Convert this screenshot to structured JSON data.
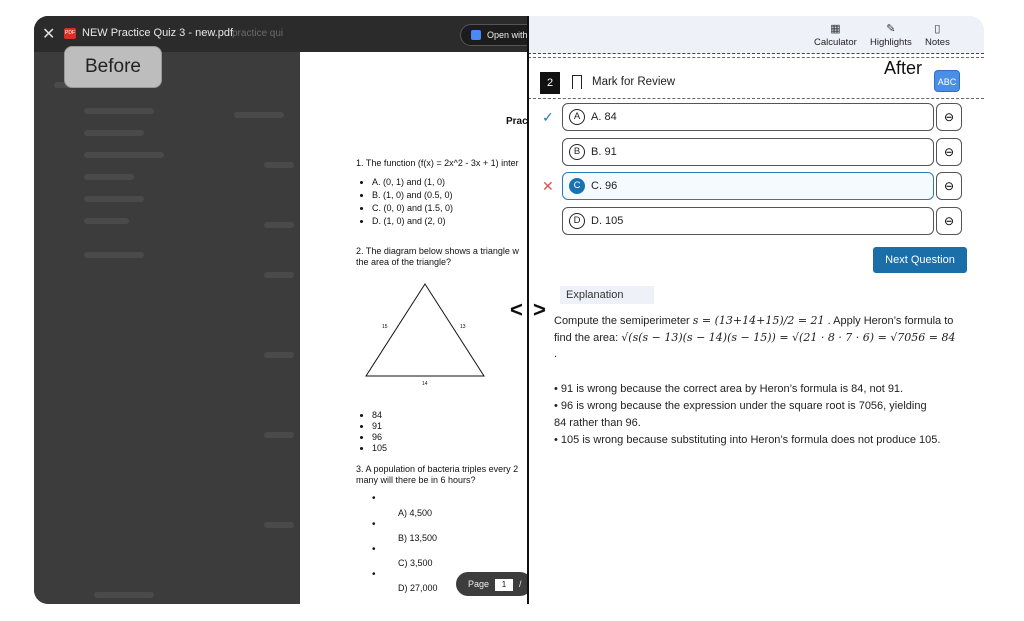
{
  "before": {
    "badge": "Before",
    "file_name": "NEW Practice Quiz 3 - new.pdf",
    "search_text": "practice qui",
    "open_with_label": "Open with",
    "pdf": {
      "title": "Prac",
      "q1": "1. The function (f(x) = 2x^2 - 3x + 1) inter",
      "q1_options": [
        "A. (0, 1) and (1, 0)",
        "B. (1, 0) and (0.5, 0)",
        "C. (0, 0) and (1.5, 0)",
        "D. (1, 0) and (2, 0)"
      ],
      "q2": "2. The diagram below shows a triangle w",
      "q2_line2": "the area of the triangle?",
      "triangle_labels": [
        "15",
        "13",
        "14"
      ],
      "q2_options": [
        "84",
        "91",
        "96",
        "105"
      ],
      "q3": "3. A population of bacteria triples every 2",
      "q3_line2": "many will there be in 6 hours?",
      "q3_options": [
        "A) 4,500",
        "B) 13,500",
        "C) 3,500",
        "D) 27,000"
      ]
    },
    "page_label": "Page",
    "page_number": "1",
    "page_sep": "/"
  },
  "after": {
    "badge": "After",
    "abc_label": "ABC",
    "toolbar": [
      {
        "label": "Calculator",
        "icon": "calculator-icon",
        "glyph": "▦"
      },
      {
        "label": "Highlights",
        "icon": "highlighter-icon",
        "glyph": "✎"
      },
      {
        "label": "Notes",
        "icon": "notes-icon",
        "glyph": "▯"
      }
    ],
    "question_number": "2",
    "mark_review": "Mark for Review",
    "choices": [
      {
        "letter": "A",
        "text": "A. 84",
        "status": "correct",
        "status_glyph": "✓"
      },
      {
        "letter": "B",
        "text": "B. 91",
        "status": "",
        "status_glyph": ""
      },
      {
        "letter": "C",
        "text": "C. 96",
        "status": "wrong",
        "status_glyph": "✕"
      },
      {
        "letter": "D",
        "text": "D. 105",
        "status": "",
        "status_glyph": ""
      }
    ],
    "next_button": "Next Question",
    "explanation_label": "Explanation",
    "explanation": {
      "line1_pre": "Compute the semiperimeter ",
      "line1_math": "s = (13+14+15)/2 = 21",
      "line1_post": " . Apply Heron’s formula to",
      "line2_pre": "find the area: ",
      "line2_math": "√(s(s − 13)(s − 14)(s − 15)) = √(21 · 8 · 7 · 6) = √7056 = 84",
      "line3": ".",
      "bullets": [
        "• 91 is wrong because the correct area by Heron’s formula is 84, not 91.",
        "• 96 is wrong because the expression under the square root is 7056, yielding",
        "84 rather than 96.",
        "• 105 is wrong because substituting into Heron’s formula does not produce 105."
      ]
    },
    "colors": {
      "accent": "#1a6fa8",
      "correct": "#2a7cb5",
      "wrong": "#d9534f"
    }
  },
  "compare_arrows": "< >"
}
